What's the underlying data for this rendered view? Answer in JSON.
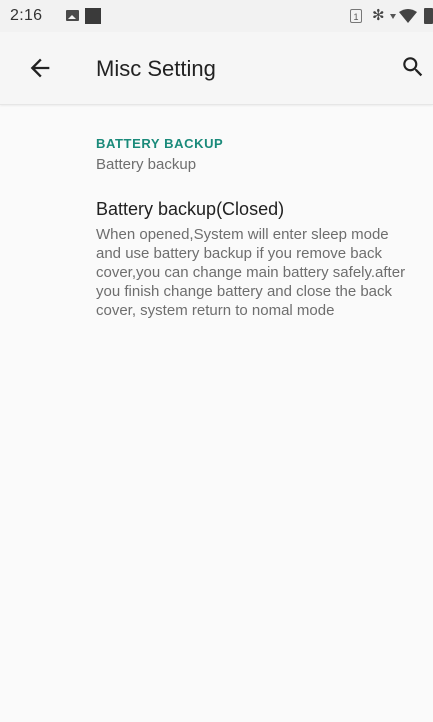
{
  "status_bar": {
    "time": "2:16",
    "sim_badge": "1",
    "bluetooth_glyph": "✻",
    "icons": [
      "image-icon",
      "notification-square-icon",
      "sim-icon",
      "bluetooth-icon",
      "signal-icon",
      "wifi-icon",
      "battery-icon"
    ]
  },
  "app_bar": {
    "title": "Misc Setting",
    "back_icon": "arrow-back-icon",
    "search_icon": "search-icon"
  },
  "preferences": {
    "category_title": "BATTERY BACKUP",
    "category_summary": "Battery backup",
    "item_title": "Battery backup(Closed)",
    "item_summary": "When opened,System will enter sleep mode and use battery backup if you remove back cover,you can change main battery safely.after you finish change battery and close the back cover, system return to nomal mode"
  },
  "colors": {
    "accent": "#1a8a7a",
    "background": "#fafafa",
    "text_primary": "#212121",
    "text_secondary": "#6e6e6e"
  }
}
